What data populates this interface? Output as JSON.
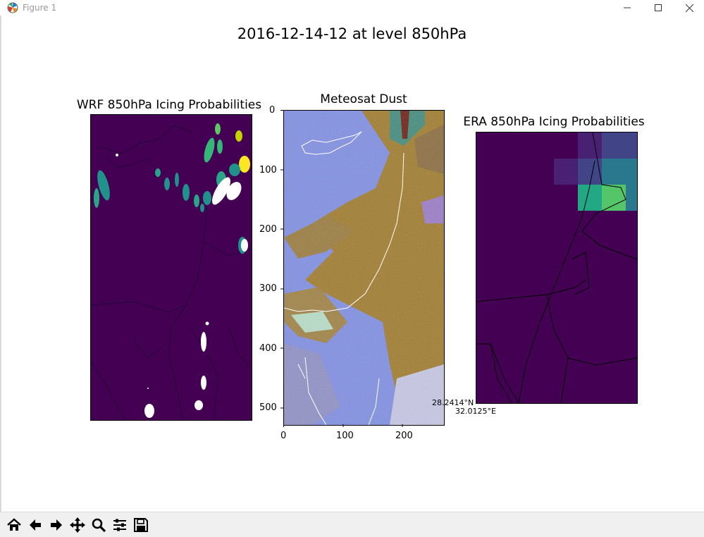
{
  "window": {
    "title": "Figure 1"
  },
  "figure": {
    "suptitle": "2016-12-14-12 at level 850hPa",
    "panels": [
      {
        "title": "WRF 850hPa Icing Probabilities"
      },
      {
        "title": "Meteosat Dust",
        "yticks": [
          "0",
          "100",
          "200",
          "300",
          "400",
          "500"
        ],
        "xticks": [
          "0",
          "100",
          "200"
        ]
      },
      {
        "title": "ERA 850hPa Icing Probabilities"
      }
    ],
    "coord_readout": {
      "lat": "28.2414°N",
      "lon": "32.0125°E"
    }
  },
  "colors": {
    "viridis_dark": "#440154",
    "dust_blue": "#7b8ef0",
    "dust_brown": "#a87b1e"
  },
  "toolbar": {
    "buttons": [
      "home-icon",
      "back-arrow-icon",
      "forward-arrow-icon",
      "pan-icon",
      "zoom-icon",
      "configure-subplots-icon",
      "save-icon"
    ]
  },
  "status_text": "…"
}
